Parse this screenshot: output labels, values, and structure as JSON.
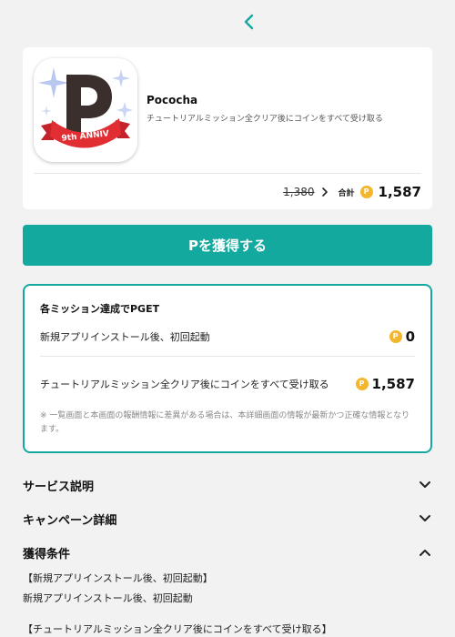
{
  "header": {
    "back_icon": "chevron-left-icon"
  },
  "app": {
    "name": "Pococha",
    "description": "チュートリアルミッション全クリア後にコインをすべて受け取る",
    "icon_letter": "P",
    "icon_ribbon": "9th ANNIV",
    "old_price": "1,380",
    "total_label": "合計",
    "total_value": "1,587",
    "coin_symbol": "P"
  },
  "cta": {
    "label": "Pを獲得する"
  },
  "missions": {
    "title": "各ミッション達成でPGET",
    "items": [
      {
        "label": "新規アプリインストール後、初回起動",
        "value": "0"
      },
      {
        "label": "チュートリアルミッション全クリア後にコインをすべて受け取る",
        "value": "1,587"
      }
    ],
    "note": "※ 一覧画面と本画面の報酬情報に差異がある場合は、本詳細画面の情報が最新かつ正確な情報となります。"
  },
  "sections": [
    {
      "title": "サービス説明",
      "state": "collapsed"
    },
    {
      "title": "キャンペーン詳細",
      "state": "collapsed"
    },
    {
      "title": "獲得条件",
      "state": "expanded"
    }
  ],
  "conditions": [
    "【新規アプリインストール後、初回起動】",
    "新規アプリインストール後、初回起動",
    "【チュートリアルミッション全クリア後にコインをすべて受け取る】"
  ],
  "colors": {
    "accent": "#13a99f",
    "coin": "#f3b62c",
    "background": "#f2f2f2"
  }
}
